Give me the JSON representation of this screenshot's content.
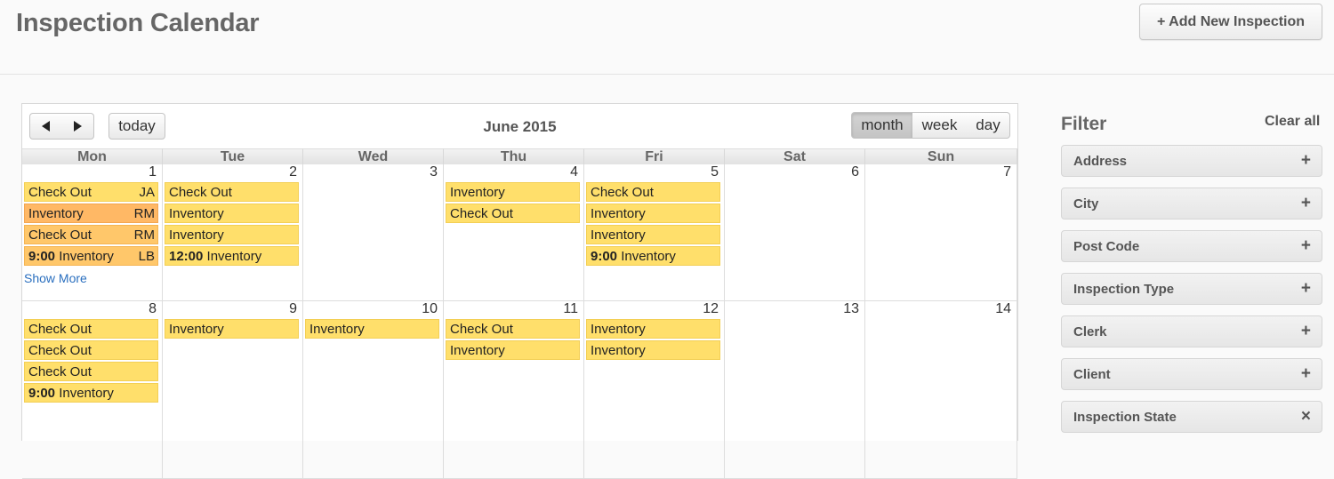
{
  "header": {
    "title": "Inspection Calendar",
    "add_button": "+ Add New Inspection"
  },
  "toolbar": {
    "today": "today",
    "month_title": "June 2015",
    "view_month": "month",
    "view_week": "week",
    "view_day": "day",
    "active_view": "month"
  },
  "weekdays": [
    "Mon",
    "Tue",
    "Wed",
    "Thu",
    "Fri",
    "Sat",
    "Sun"
  ],
  "weeks": [
    {
      "days": [
        {
          "num": "1",
          "events": [
            {
              "time": "",
              "label": "Check Out",
              "who": "JA",
              "color": "yellow"
            },
            {
              "time": "",
              "label": "Inventory",
              "who": "RM",
              "color": "orange"
            },
            {
              "time": "",
              "label": "Check Out",
              "who": "RM",
              "color": "orange2"
            },
            {
              "time": "9:00",
              "label": "Inventory",
              "who": "LB",
              "color": "orange2"
            }
          ],
          "more": "Show More"
        },
        {
          "num": "2",
          "events": [
            {
              "time": "",
              "label": "Check Out",
              "who": "",
              "color": "yellow"
            },
            {
              "time": "",
              "label": "Inventory",
              "who": "",
              "color": "yellow"
            },
            {
              "time": "",
              "label": "Inventory",
              "who": "",
              "color": "yellow"
            },
            {
              "time": "12:00",
              "label": "Inventory",
              "who": "",
              "color": "yellow"
            }
          ]
        },
        {
          "num": "3",
          "events": []
        },
        {
          "num": "4",
          "events": [
            {
              "time": "",
              "label": "Inventory",
              "who": "",
              "color": "yellow"
            },
            {
              "time": "",
              "label": "Check Out",
              "who": "",
              "color": "yellow"
            }
          ]
        },
        {
          "num": "5",
          "events": [
            {
              "time": "",
              "label": "Check Out",
              "who": "",
              "color": "yellow"
            },
            {
              "time": "",
              "label": "Inventory",
              "who": "",
              "color": "yellow"
            },
            {
              "time": "",
              "label": "Inventory",
              "who": "",
              "color": "yellow"
            },
            {
              "time": "9:00",
              "label": "Inventory",
              "who": "",
              "color": "yellow"
            }
          ]
        },
        {
          "num": "6",
          "events": []
        },
        {
          "num": "7",
          "events": []
        }
      ]
    },
    {
      "days": [
        {
          "num": "8",
          "events": [
            {
              "time": "",
              "label": "Check Out",
              "who": "",
              "color": "yellow"
            },
            {
              "time": "",
              "label": "Check Out",
              "who": "",
              "color": "yellow"
            },
            {
              "time": "",
              "label": "Check Out",
              "who": "",
              "color": "yellow"
            },
            {
              "time": "9:00",
              "label": "Inventory",
              "who": "",
              "color": "yellow"
            }
          ]
        },
        {
          "num": "9",
          "events": [
            {
              "time": "",
              "label": "Inventory",
              "who": "",
              "color": "yellow"
            }
          ]
        },
        {
          "num": "10",
          "events": [
            {
              "time": "",
              "label": "Inventory",
              "who": "",
              "color": "yellow"
            }
          ]
        },
        {
          "num": "11",
          "events": [
            {
              "time": "",
              "label": "Check Out",
              "who": "",
              "color": "yellow"
            },
            {
              "time": "",
              "label": "Inventory",
              "who": "",
              "color": "yellow"
            }
          ]
        },
        {
          "num": "12",
          "events": [
            {
              "time": "",
              "label": "Inventory",
              "who": "",
              "color": "yellow"
            },
            {
              "time": "",
              "label": "Inventory",
              "who": "",
              "color": "yellow"
            }
          ]
        },
        {
          "num": "13",
          "events": []
        },
        {
          "num": "14",
          "events": []
        }
      ]
    }
  ],
  "filter": {
    "title": "Filter",
    "clear_all": "Clear all",
    "facets": [
      {
        "label": "Address",
        "sign": "+"
      },
      {
        "label": "City",
        "sign": "+"
      },
      {
        "label": "Post Code",
        "sign": "+"
      },
      {
        "label": "Inspection Type",
        "sign": "+"
      },
      {
        "label": "Clerk",
        "sign": "+"
      },
      {
        "label": "Client",
        "sign": "+"
      },
      {
        "label": "Inspection State",
        "sign": "×"
      }
    ]
  }
}
